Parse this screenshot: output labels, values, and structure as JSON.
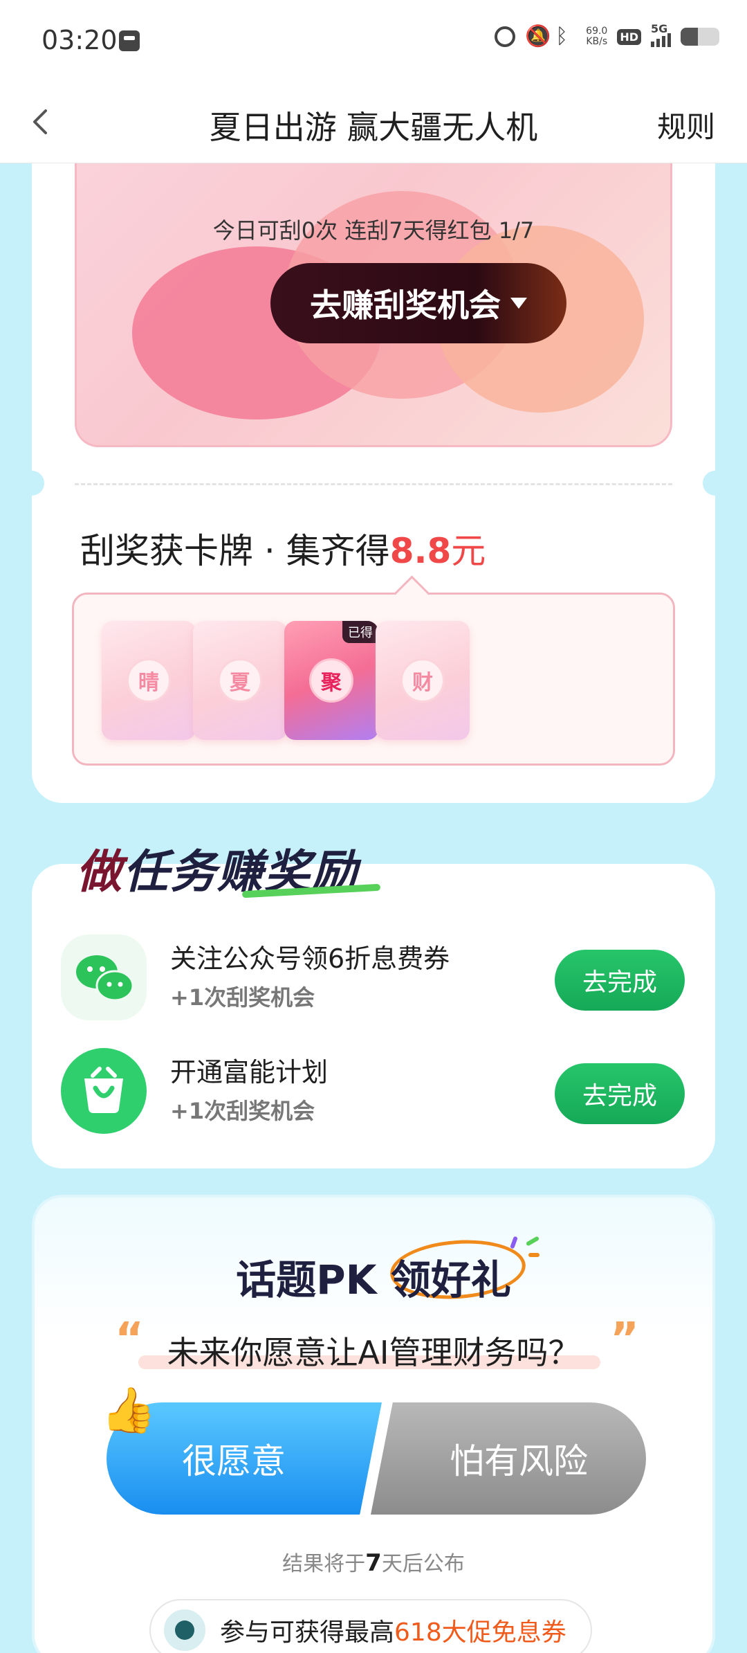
{
  "status_bar": {
    "time": "03:20",
    "net_speed_value": "69.0",
    "net_speed_unit": "KB/s",
    "hd": "HD",
    "network": "5G",
    "battery_level": 0.45
  },
  "header": {
    "title": "夏日出游 赢大疆无人机",
    "rules": "规则"
  },
  "scratch": {
    "count_text": "今日可刮0次 连刮7天得红包 1/7",
    "earn_button": "去赚刮奖机会"
  },
  "collect": {
    "title_prefix": "刮奖获卡牌 · 集齐得",
    "amount": "8.8",
    "unit": "元",
    "cards": [
      {
        "char": "晴",
        "obtained": false
      },
      {
        "char": "夏",
        "obtained": false
      },
      {
        "char": "聚",
        "obtained": true,
        "badge": "已得"
      },
      {
        "char": "财",
        "obtained": false
      }
    ]
  },
  "tasks": {
    "heading_first": "做",
    "heading_rest": "任务赚奖励",
    "items": [
      {
        "title": "关注公众号领6折息费券",
        "sub": "+1次刮奖机会",
        "button": "去完成",
        "icon": "wechat-icon"
      },
      {
        "title": "开通富能计划",
        "sub": "+1次刮奖机会",
        "button": "去完成",
        "icon": "shopping-bag-icon"
      }
    ]
  },
  "pk": {
    "title": "话题PK 领好礼",
    "question": "未来你愿意让AI管理财务吗？",
    "open_quote": "“",
    "close_quote": "”",
    "yes": "很愿意",
    "no": "怕有风险",
    "result_prefix": "结果将于",
    "result_days": "7",
    "result_suffix": "天后公布",
    "reward_prefix": "参与可获得最高",
    "reward_highlight": "618大促免息券"
  },
  "colors": {
    "page_bg": "#c6f1fa",
    "accent_red": "#f04848",
    "task_green": "#15a957",
    "pk_blue": "#1a8ef0",
    "pk_gray": "#8c8c8c",
    "reward_orange": "#f05a1a"
  }
}
